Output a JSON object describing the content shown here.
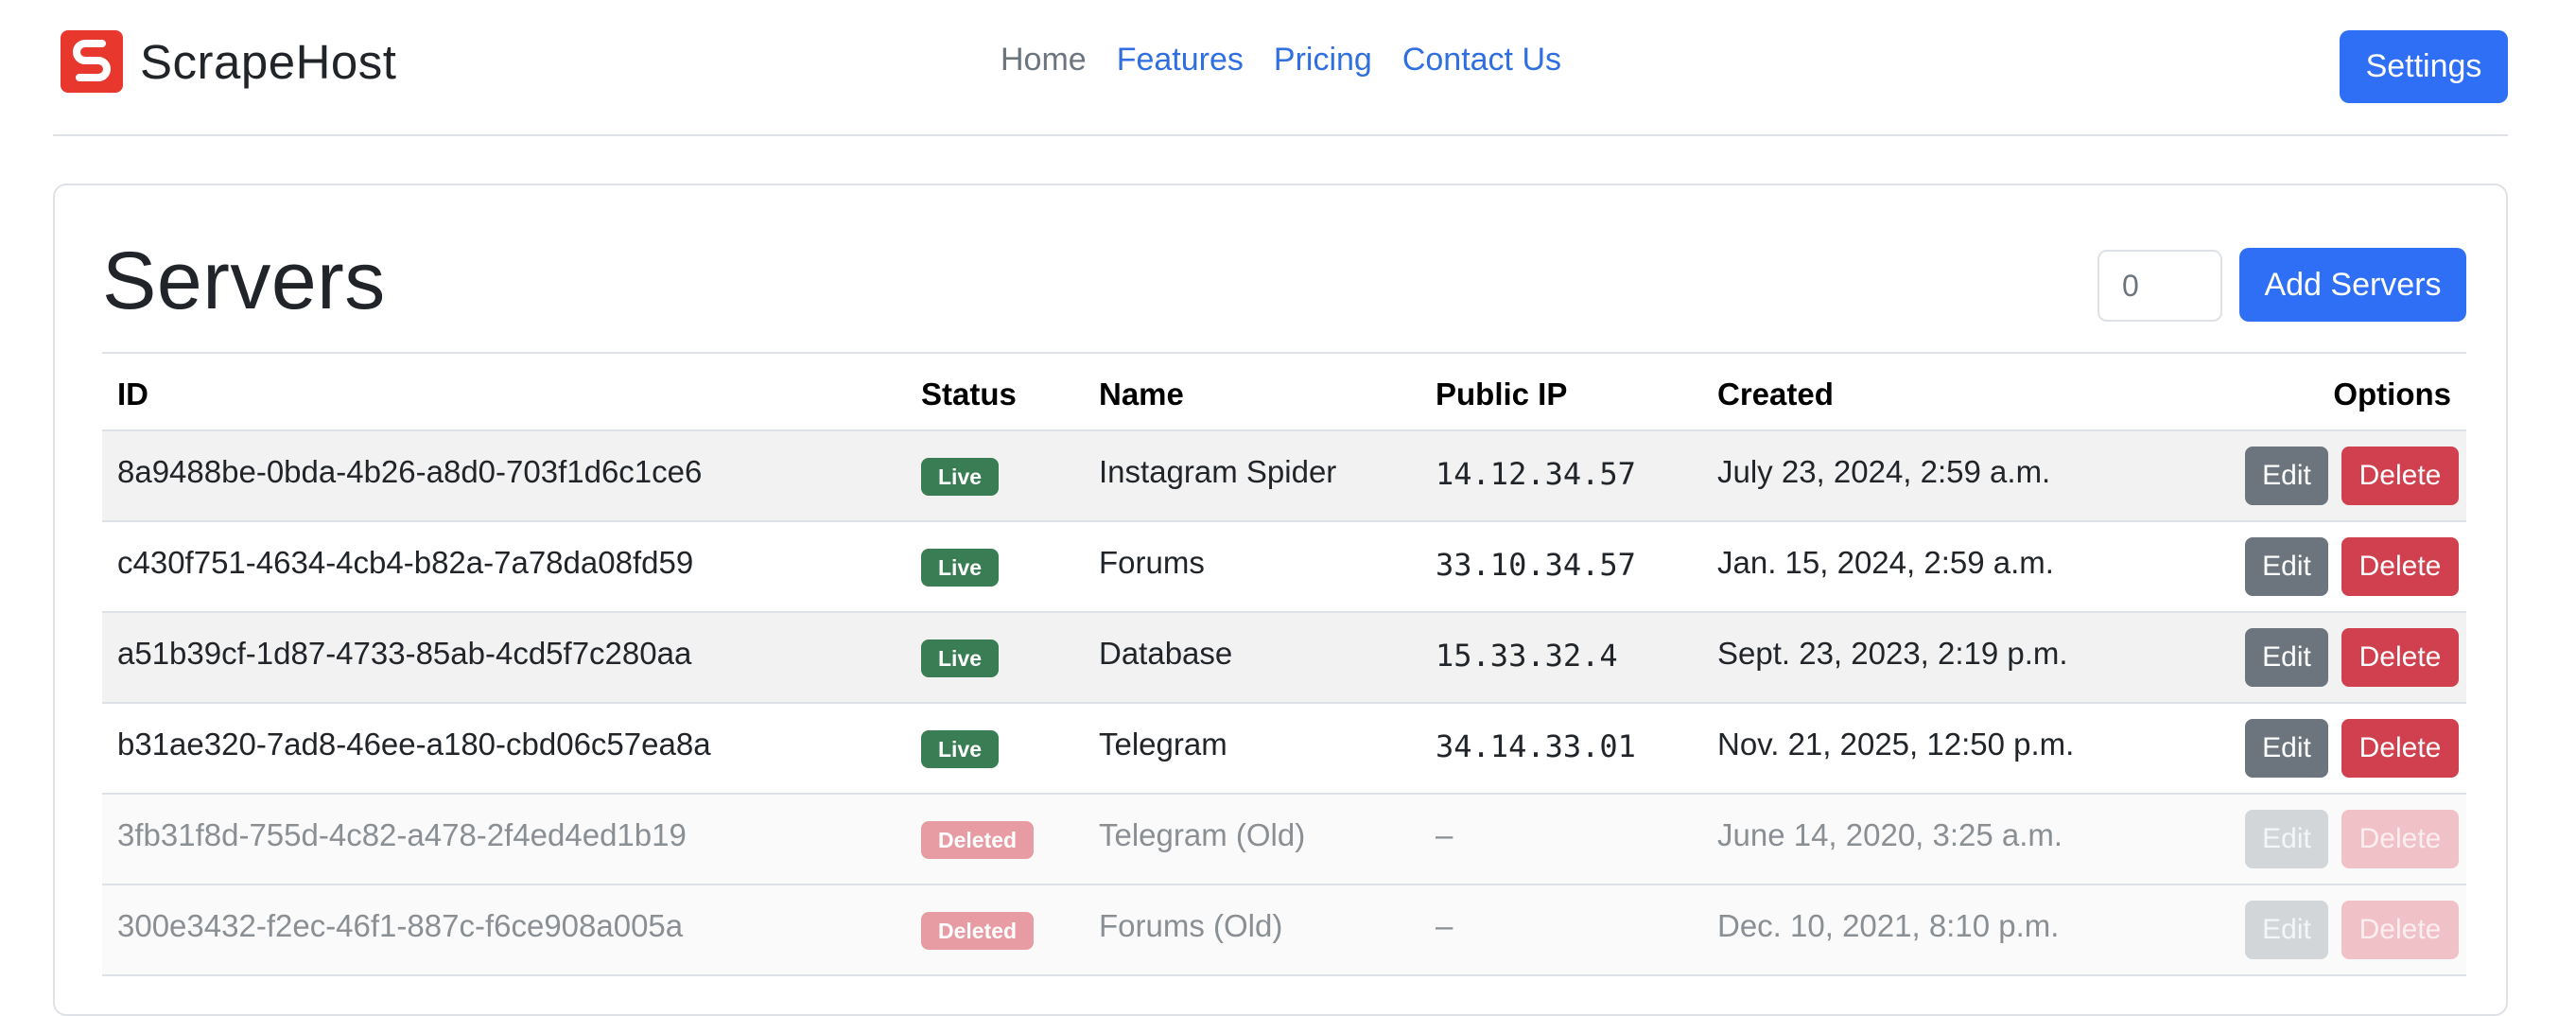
{
  "brand": {
    "name": "ScrapeHost",
    "logo_icon": "scrapehost-logo-icon",
    "logo_color": "#e8372c"
  },
  "nav": {
    "links": [
      {
        "label": "Home",
        "active": true
      },
      {
        "label": "Features",
        "active": false
      },
      {
        "label": "Pricing",
        "active": false
      },
      {
        "label": "Contact Us",
        "active": false
      }
    ],
    "settings_label": "Settings"
  },
  "servers": {
    "title": "Servers",
    "count_value": "0",
    "add_label": "Add Servers",
    "columns": [
      "ID",
      "Status",
      "Name",
      "Public IP",
      "Created",
      "Options"
    ],
    "rows": [
      {
        "id": "8a9488be-0bda-4b26-a8d0-703f1d6c1ce6",
        "status": "Live",
        "name": "Instagram Spider",
        "ip": "14.12.34.57",
        "created": "July 23, 2024, 2:59 a.m.",
        "edit": "Edit",
        "delete": "Delete"
      },
      {
        "id": "c430f751-4634-4cb4-b82a-7a78da08fd59",
        "status": "Live",
        "name": "Forums",
        "ip": "33.10.34.57",
        "created": "Jan. 15, 2024, 2:59 a.m.",
        "edit": "Edit",
        "delete": "Delete"
      },
      {
        "id": "a51b39cf-1d87-4733-85ab-4cd5f7c280aa",
        "status": "Live",
        "name": "Database",
        "ip": "15.33.32.4",
        "created": "Sept. 23, 2023, 2:19 p.m.",
        "edit": "Edit",
        "delete": "Delete"
      },
      {
        "id": "b31ae320-7ad8-46ee-a180-cbd06c57ea8a",
        "status": "Live",
        "name": "Telegram",
        "ip": "34.14.33.01",
        "created": "Nov. 21, 2025, 12:50 p.m.",
        "edit": "Edit",
        "delete": "Delete"
      },
      {
        "id": "3fb31f8d-755d-4c82-a478-2f4ed4ed1b19",
        "status": "Deleted",
        "name": "Telegram (Old)",
        "ip": "–",
        "created": "June 14, 2020, 3:25 a.m.",
        "edit": "Edit",
        "delete": "Delete"
      },
      {
        "id": "300e3432-f2ec-46f1-887c-f6ce908a005a",
        "status": "Deleted",
        "name": "Forums (Old)",
        "ip": "–",
        "created": "Dec. 10, 2021, 8:10 p.m.",
        "edit": "Edit",
        "delete": "Delete"
      }
    ]
  },
  "colors": {
    "primary": "#2f6ff5",
    "live": "#3a7d55",
    "deleted": "#e79ca3",
    "danger": "#d0404f",
    "secondary": "#6c757d"
  }
}
